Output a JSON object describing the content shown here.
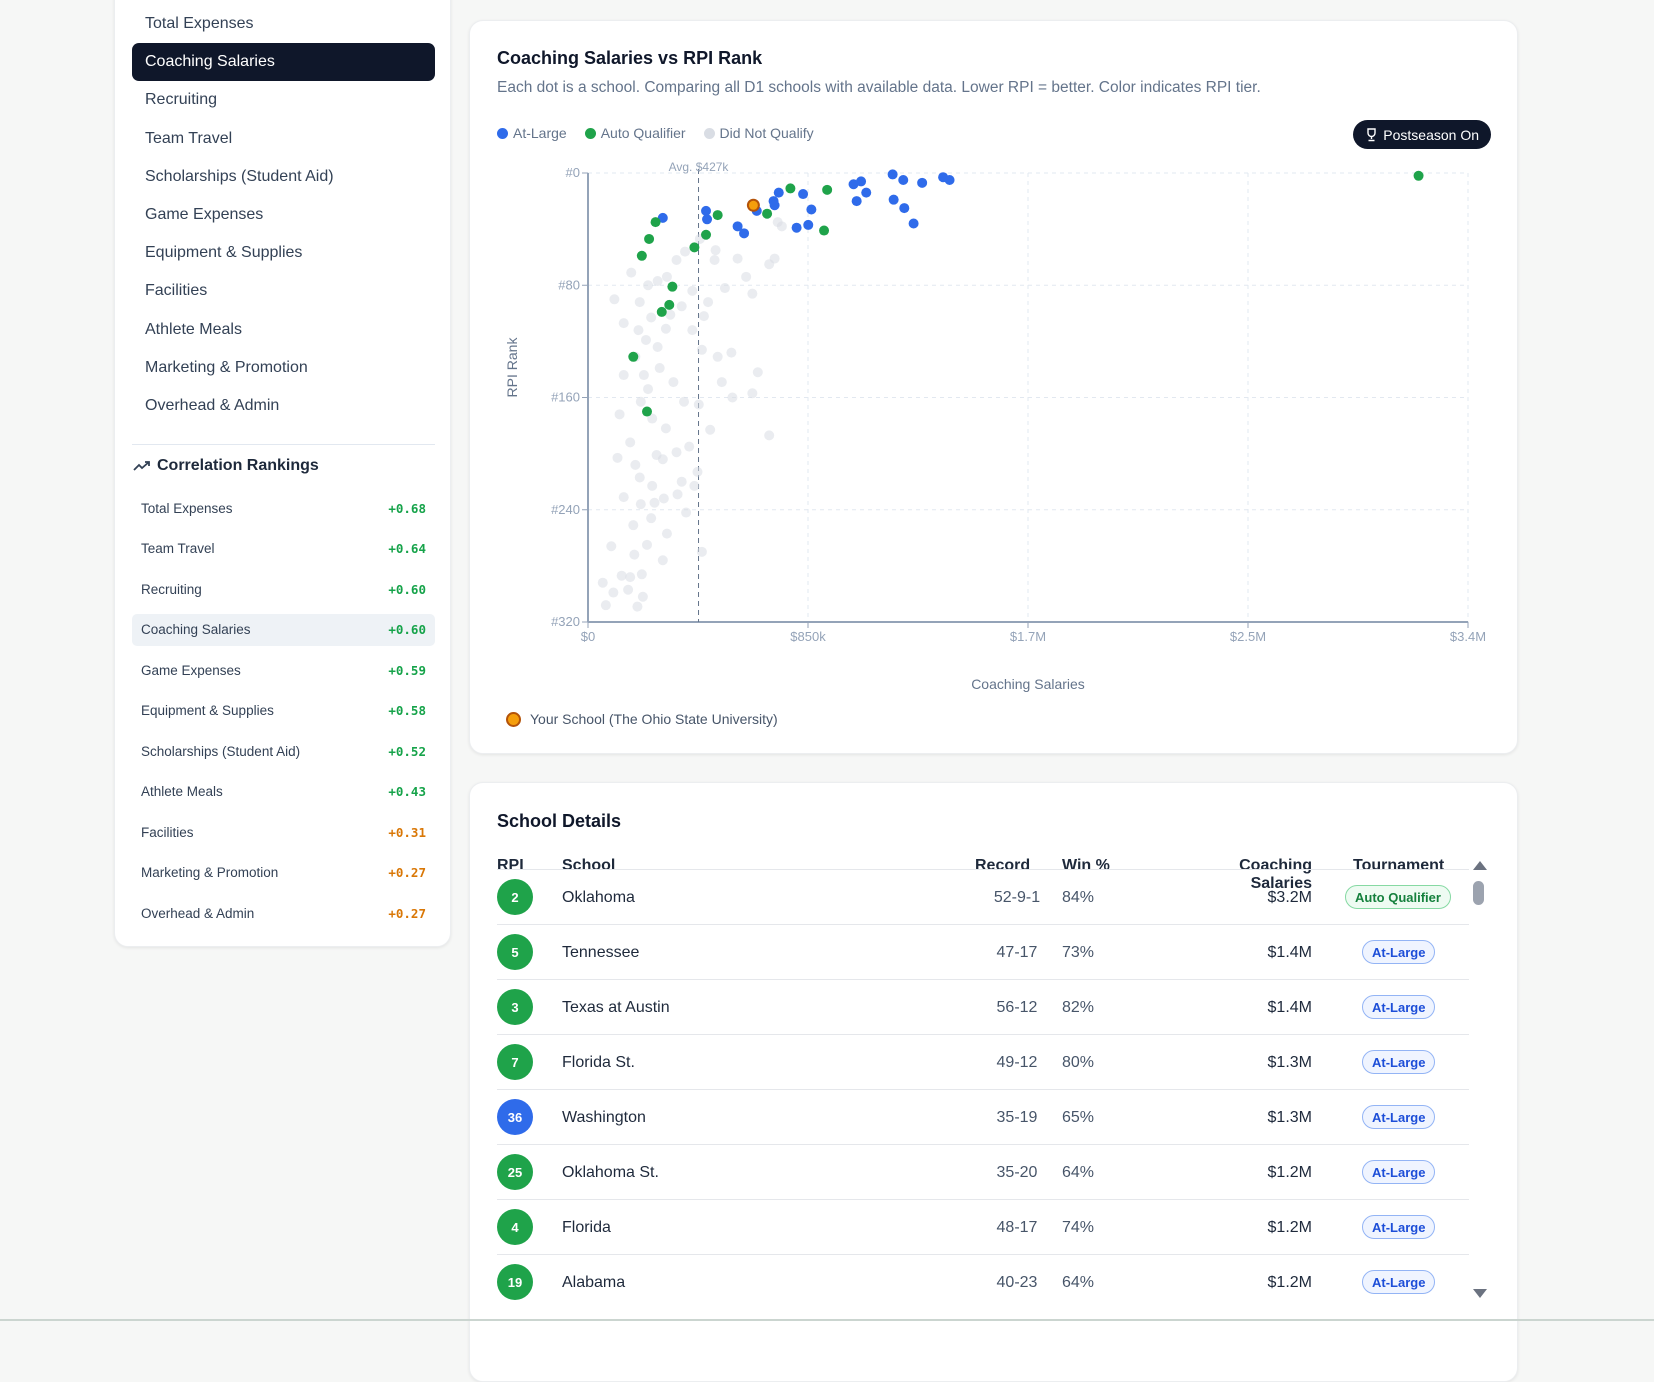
{
  "sidebar": {
    "items": [
      "Total Expenses",
      "Coaching Salaries",
      "Recruiting",
      "Team Travel",
      "Scholarships (Student Aid)",
      "Game Expenses",
      "Equipment & Supplies",
      "Facilities",
      "Athlete Meals",
      "Marketing & Promotion",
      "Overhead & Admin"
    ],
    "active": 1,
    "correlation_title": "Correlation Rankings",
    "correlations": [
      {
        "label": "Total Expenses",
        "value": "+0.68"
      },
      {
        "label": "Team Travel",
        "value": "+0.64"
      },
      {
        "label": "Recruiting",
        "value": "+0.60"
      },
      {
        "label": "Coaching Salaries",
        "value": "+0.60"
      },
      {
        "label": "Game Expenses",
        "value": "+0.59"
      },
      {
        "label": "Equipment & Supplies",
        "value": "+0.58"
      },
      {
        "label": "Scholarships (Student Aid)",
        "value": "+0.52"
      },
      {
        "label": "Athlete Meals",
        "value": "+0.43"
      },
      {
        "label": "Facilities",
        "value": "+0.31"
      },
      {
        "label": "Marketing & Promotion",
        "value": "+0.27"
      },
      {
        "label": "Overhead & Admin",
        "value": "+0.27"
      }
    ]
  },
  "colors": {
    "at_large": "#2f6bea",
    "auto": "#1fa34a",
    "dnq": "#d9dde4",
    "you": "#f59e0b",
    "you_border": "#b45309",
    "corr_high": "#16a34a",
    "corr_low": "#d97706"
  },
  "chart": {
    "title": "Coaching Salaries vs RPI Rank",
    "subtitle": "Each dot is a school. Comparing all D1 schools with available data. Lower RPI = better. Color indicates RPI tier.",
    "postseason_label": "Postseason On",
    "your_school_label": "Your School (The Ohio State University)"
  },
  "chart_data": {
    "type": "scatter",
    "xlabel": "Coaching Salaries",
    "ylabel": "RPI Rank",
    "xlim": [
      0,
      3400
    ],
    "ylim": [
      0,
      320
    ],
    "x_units": "$k",
    "x_ticks": [
      {
        "v": 0,
        "label": "$0"
      },
      {
        "v": 850,
        "label": "$850k"
      },
      {
        "v": 1700,
        "label": "$1.7M"
      },
      {
        "v": 2550,
        "label": "$2.5M"
      },
      {
        "v": 3400,
        "label": "$3.4M"
      }
    ],
    "y_ticks": [
      {
        "v": 0,
        "label": "#0"
      },
      {
        "v": 80,
        "label": "#80"
      },
      {
        "v": 160,
        "label": "#160"
      },
      {
        "v": 240,
        "label": "#240"
      },
      {
        "v": 320,
        "label": "#320"
      }
    ],
    "avg_line": {
      "value": 427,
      "label": "Avg. $427k"
    },
    "legend": [
      "At-Large",
      "Auto Qualifier",
      "Did Not Qualify"
    ],
    "series": [
      {
        "name": "Did Not Qualify",
        "points": [
          [
            167,
            71
          ],
          [
            102,
            90
          ],
          [
            200,
            92
          ],
          [
            232,
            80
          ],
          [
            269,
            77
          ],
          [
            305,
            74
          ],
          [
            342,
            62
          ],
          [
            375,
            56
          ],
          [
            432,
            47
          ],
          [
            489,
            62
          ],
          [
            529,
            82
          ],
          [
            611,
            74
          ],
          [
            635,
            86
          ],
          [
            721,
            61
          ],
          [
            138,
            107
          ],
          [
            195,
            112
          ],
          [
            224,
            119
          ],
          [
            269,
            124
          ],
          [
            301,
            111
          ],
          [
            318,
            101
          ],
          [
            362,
            95
          ],
          [
            403,
            84
          ],
          [
            448,
            102
          ],
          [
            440,
            126
          ],
          [
            501,
            131
          ],
          [
            554,
            128
          ],
          [
            517,
            149
          ],
          [
            558,
            160
          ],
          [
            635,
            157
          ],
          [
            656,
            142
          ],
          [
            700,
            187
          ],
          [
            472,
            183
          ],
          [
            428,
            165
          ],
          [
            371,
            163
          ],
          [
            301,
            182
          ],
          [
            248,
            175
          ],
          [
            183,
            131
          ],
          [
            216,
            144
          ],
          [
            232,
            154
          ],
          [
            277,
            139
          ],
          [
            330,
            149
          ],
          [
            122,
            172
          ],
          [
            163,
            192
          ],
          [
            114,
            203
          ],
          [
            183,
            208
          ],
          [
            265,
            201
          ],
          [
            289,
            204
          ],
          [
            342,
            199
          ],
          [
            391,
            195
          ],
          [
            200,
            217
          ],
          [
            248,
            223
          ],
          [
            362,
            220
          ],
          [
            411,
            223
          ],
          [
            293,
            232
          ],
          [
            204,
            236
          ],
          [
            175,
            251
          ],
          [
            244,
            246
          ],
          [
            305,
            257
          ],
          [
            379,
            242
          ],
          [
            228,
            265
          ],
          [
            289,
            276
          ],
          [
            179,
            272
          ],
          [
            90,
            266
          ],
          [
            130,
            287
          ],
          [
            163,
            288
          ],
          [
            208,
            286
          ],
          [
            57,
            292
          ],
          [
            98,
            299
          ],
          [
            155,
            297
          ],
          [
            212,
            302
          ],
          [
            69,
            308
          ],
          [
            191,
            309
          ],
          [
            440,
            270
          ],
          [
            138,
            231
          ],
          [
            257,
            235
          ],
          [
            346,
            229
          ],
          [
            423,
            213
          ],
          [
            204,
            163
          ],
          [
            138,
            144
          ],
          [
            244,
            103
          ],
          [
            403,
            112
          ],
          [
            464,
            92
          ],
          [
            578,
            61
          ],
          [
            493,
            55
          ],
          [
            733,
            35
          ],
          [
            749,
            38
          ],
          [
            700,
            65
          ]
        ]
      },
      {
        "name": "At-Large",
        "points": [
          [
            289,
            32
          ],
          [
            456,
            27
          ],
          [
            460,
            33
          ],
          [
            578,
            38
          ],
          [
            603,
            43
          ],
          [
            652,
            27
          ],
          [
            717,
            20
          ],
          [
            737,
            14
          ],
          [
            721,
            23
          ],
          [
            831,
            15
          ],
          [
            863,
            26
          ],
          [
            851,
            37
          ],
          [
            806,
            39
          ],
          [
            1026,
            8
          ],
          [
            1055,
            6
          ],
          [
            1075,
            14
          ],
          [
            1038,
            20
          ],
          [
            1177,
            1
          ],
          [
            1218,
            5
          ],
          [
            1291,
            7
          ],
          [
            1181,
            19
          ],
          [
            1222,
            25
          ],
          [
            1258,
            36
          ],
          [
            1372,
            3
          ],
          [
            1397,
            5
          ]
        ]
      },
      {
        "name": "Auto Qualifier",
        "points": [
          [
            261,
            35
          ],
          [
            236,
            47
          ],
          [
            208,
            59
          ],
          [
            411,
            53
          ],
          [
            456,
            44
          ],
          [
            501,
            30
          ],
          [
            692,
            29
          ],
          [
            782,
            11
          ],
          [
            924,
            12
          ],
          [
            912,
            41
          ],
          [
            326,
            81
          ],
          [
            314,
            94
          ],
          [
            285,
            99
          ],
          [
            175,
            131
          ],
          [
            228,
            170
          ],
          [
            3209,
            2
          ]
        ]
      },
      {
        "name": "Your School",
        "points": [
          [
            639,
            23
          ]
        ]
      }
    ]
  },
  "table": {
    "title": "School Details",
    "headers": [
      "RPI",
      "School",
      "Record",
      "Win %",
      "Coaching Salaries",
      "Tournament"
    ],
    "rows": [
      {
        "rpi": "2",
        "school": "Oklahoma",
        "record": "52-9-1",
        "win": "84%",
        "salary": "$3.2M",
        "tournament": "Auto Qualifier",
        "tier": "top"
      },
      {
        "rpi": "5",
        "school": "Tennessee",
        "record": "47-17",
        "win": "73%",
        "salary": "$1.4M",
        "tournament": "At-Large",
        "tier": "top"
      },
      {
        "rpi": "3",
        "school": "Texas at Austin",
        "record": "56-12",
        "win": "82%",
        "salary": "$1.4M",
        "tournament": "At-Large",
        "tier": "top"
      },
      {
        "rpi": "7",
        "school": "Florida St.",
        "record": "49-12",
        "win": "80%",
        "salary": "$1.3M",
        "tournament": "At-Large",
        "tier": "top"
      },
      {
        "rpi": "36",
        "school": "Washington",
        "record": "35-19",
        "win": "65%",
        "salary": "$1.3M",
        "tournament": "At-Large",
        "tier": "mid"
      },
      {
        "rpi": "25",
        "school": "Oklahoma St.",
        "record": "35-20",
        "win": "64%",
        "salary": "$1.2M",
        "tournament": "At-Large",
        "tier": "top"
      },
      {
        "rpi": "4",
        "school": "Florida",
        "record": "48-17",
        "win": "74%",
        "salary": "$1.2M",
        "tournament": "At-Large",
        "tier": "top"
      },
      {
        "rpi": "19",
        "school": "Alabama",
        "record": "40-23",
        "win": "64%",
        "salary": "$1.2M",
        "tournament": "At-Large",
        "tier": "top"
      }
    ]
  }
}
